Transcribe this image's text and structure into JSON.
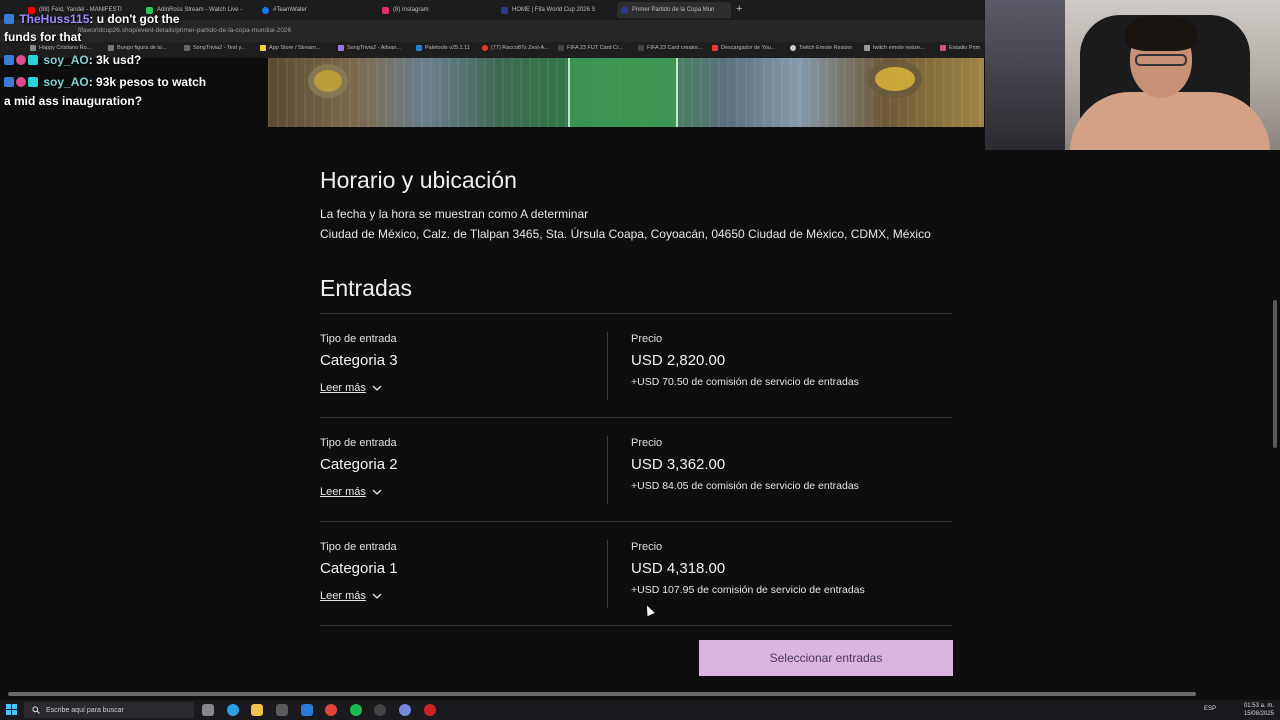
{
  "browser": {
    "tabs": [
      {
        "label": "(88) Feid, Yandel - MANIFESTI",
        "icon_color": "#ff0000"
      },
      {
        "label": "AdinRoss Stream - Watch Live -",
        "icon_color": "#35c35a"
      },
      {
        "label": "#TeamWater",
        "icon_color": "#1877f2"
      },
      {
        "label": "(8) Instagram",
        "icon_color": "#e1306c"
      },
      {
        "label": "HOME | Fifa World Cup 2026 S",
        "icon_color": "#2b3a8c"
      },
      {
        "label": "Primer Partido de la Copa Mun",
        "icon_color": "#2b3a8c"
      }
    ],
    "new_tab": "+",
    "url": "fifaworldcup26.shop/event-details/primer-partido-de-la-copa-mundial-2026",
    "bookmarks": [
      {
        "label": "Happy Cristiano Ro...",
        "icon_color": "#888"
      },
      {
        "label": "Bungo figura de to...",
        "icon_color": "#777"
      },
      {
        "label": "SongTrivia2 - Test y...",
        "icon_color": "#666"
      },
      {
        "label": "App Store / Stream...",
        "icon_color": "#f5d142"
      },
      {
        "label": "SongTrivia2 - Advan...",
        "icon_color": "#9c7ad4"
      },
      {
        "label": "Paletools v25.1.11",
        "icon_color": "#2e7ad1"
      },
      {
        "label": "(77) Racco87s Zesl-A...",
        "icon_color": "#e33"
      },
      {
        "label": "FIFA 23 FUT Card Cr...",
        "icon_color": "#444"
      },
      {
        "label": "FIFA 23 Card creator...",
        "icon_color": "#444"
      },
      {
        "label": "Descargador de You...",
        "icon_color": "#e33"
      },
      {
        "label": "Twitch Emote Resizer",
        "icon_color": "#ccc"
      },
      {
        "label": "twitch emote resize...",
        "icon_color": "#999"
      },
      {
        "label": "Estadio Prim",
        "icon_color": "#e14b8a"
      }
    ]
  },
  "chat": {
    "messages": [
      {
        "user": "TheHuss115",
        "text": ": u don't got the"
      },
      {
        "user": "",
        "text": "funds for that"
      },
      {
        "user": "soy_AO",
        "text": ": 3k usd?"
      },
      {
        "user": "soy_AO",
        "text": ": 93k pesos to watch"
      },
      {
        "user": "",
        "text": "a mid ass inauguration?"
      }
    ]
  },
  "schedule": {
    "title": "Horario y ubicación",
    "date_line": "La fecha y la hora se muestran como A determinar",
    "address": "Ciudad de México, Calz. de Tlalpan 3465, Sta. Úrsula Coapa, Coyoacán, 04650 Ciudad de México, CDMX, México"
  },
  "tickets": {
    "title": "Entradas",
    "type_label": "Tipo de entrada",
    "price_label": "Precio",
    "read_more": "Leer más",
    "items": [
      {
        "category": "Categoria 3",
        "price": "USD 2,820.00",
        "fee": "+USD 70.50 de comisión de servicio de entradas"
      },
      {
        "category": "Categoria 2",
        "price": "USD 3,362.00",
        "fee": "+USD 84.05 de comisión de servicio de entradas"
      },
      {
        "category": "Categoria 1",
        "price": "USD 4,318.00",
        "fee": "+USD 107.95 de comisión de servicio de entradas"
      }
    ],
    "select_button": "Seleccionar entradas",
    "button_color": "#dcb4e2"
  },
  "taskbar": {
    "search_placeholder": "Escribe aquí para buscar",
    "language": "ESP",
    "time": "01:53 a. m.",
    "date": "15/08/2025",
    "apps": [
      {
        "name": "task-view-icon",
        "color": "#888"
      },
      {
        "name": "edge-icon",
        "color": "#2aa0e6"
      },
      {
        "name": "file-explorer-icon",
        "color": "#f2c14e"
      },
      {
        "name": "store-icon",
        "color": "#5a5a5a"
      },
      {
        "name": "mail-icon",
        "color": "#2b7bd6"
      },
      {
        "name": "chrome-icon",
        "color": "#e0453b"
      },
      {
        "name": "spotify-icon",
        "color": "#1db954"
      },
      {
        "name": "obs-icon",
        "color": "#444"
      },
      {
        "name": "discord-icon",
        "color": "#7289da"
      },
      {
        "name": "app-red-icon",
        "color": "#c22"
      }
    ]
  }
}
